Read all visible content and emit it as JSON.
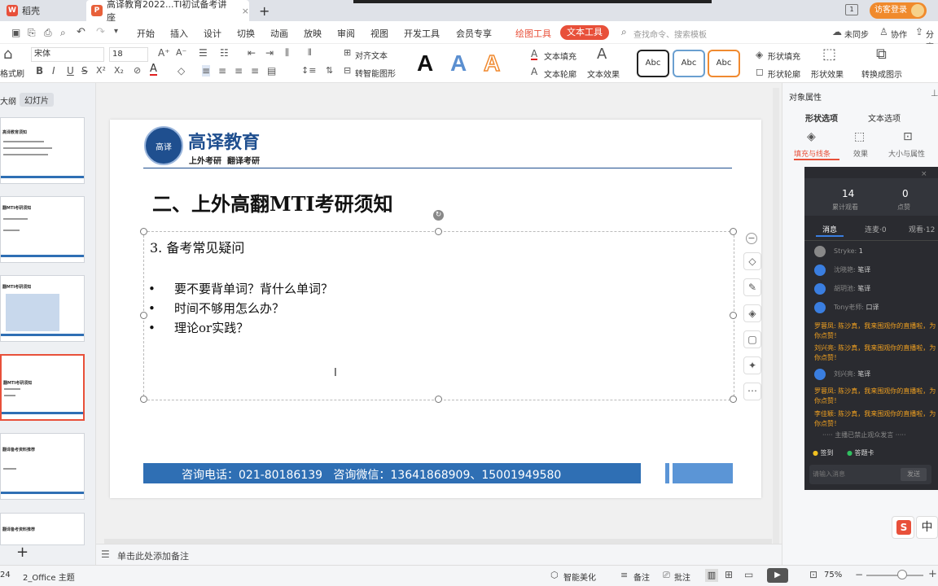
{
  "tabs": {
    "home": "稻壳",
    "doc": "高译教育2022...TI初试备考讲座",
    "add": "+"
  },
  "titlebar": {
    "login_button": "访客登录",
    "mode_icon": "1"
  },
  "menu": {
    "file": "文件",
    "items": [
      "开始",
      "插入",
      "设计",
      "切换",
      "动画",
      "放映",
      "审阅",
      "视图",
      "开发工具",
      "会员专享"
    ],
    "drawing_tool": "绘图工具",
    "text_tool": "文本工具",
    "search": "查找命令、搜索模板",
    "sync": "未同步",
    "collab": "协作",
    "share": "分享"
  },
  "ribbon": {
    "format_brush": "格式刷",
    "font_name": "宋体",
    "font_size": "18",
    "align_text": "对齐文本",
    "smart_art": "转智能图形",
    "text_fill": "文本填充",
    "text_outline": "文本轮廓",
    "text_effects": "文本效果",
    "styles": [
      "Abc",
      "Abc",
      "Abc"
    ],
    "shape_fill": "形状填充",
    "shape_outline": "形状轮廓",
    "shape_effects": "形状效果",
    "convert_to_image": "转换成图示",
    "big_a": "A",
    "bold": "B",
    "italic": "I",
    "underline": "U",
    "strike": "S"
  },
  "leftpanel": {
    "tab_outline": "大纲",
    "tab_slides": "幻灯片",
    "add": "+",
    "thumb_titles": [
      "高译教育须知",
      "翻MTI考研须知",
      "翻MTI考研须知",
      "翻MTI考研须知",
      "翻译备考资料推荐",
      "翻译备考资料推荐"
    ]
  },
  "slide": {
    "logo_name": "高译教育",
    "logo_sub": "上外考研  翻译考研",
    "title": "二、上外高翻MTI考研须知",
    "subtitle": "3. 备考常见疑问",
    "bullets": [
      "要不要背单词？背什么单词？",
      "时间不够用怎么办？",
      "理论or实践？"
    ],
    "footer": "咨询电话：021-80186139   咨询微信：13641868909、15001949580"
  },
  "notes": {
    "placeholder": "单击此处添加备注"
  },
  "rightpanel": {
    "title": "对象属性",
    "tabs": [
      "形状选项",
      "文本选项"
    ],
    "subtabs": [
      "填充与线条",
      "效果",
      "大小与属性"
    ]
  },
  "live": {
    "stats": [
      {
        "value": "14",
        "label": "累计观看"
      },
      {
        "value": "0",
        "label": "点赞"
      }
    ],
    "tabs": [
      "消息",
      "连麦·0",
      "观看·12"
    ],
    "messages": [
      {
        "user": "Stryke",
        "text": "1",
        "color": "#aaaaaa"
      },
      {
        "user": "沈晓艳",
        "text": "笔译",
        "color": "#aaaaaa"
      },
      {
        "user": "胡玥池",
        "text": "笔译",
        "color": "#aaaaaa"
      },
      {
        "user": "Tony老师",
        "text": "口译",
        "color": "#aaaaaa"
      },
      {
        "user": "罗蓉凤",
        "text": "陈沙真，我来围观你的直播啦，为你点赞！",
        "color": "#f0a020"
      },
      {
        "user": "刘兴亮",
        "text": "陈沙真，我来围观你的直播啦，为你点赞！",
        "color": "#f0a020"
      },
      {
        "user": "刘兴亮",
        "text": "笔译",
        "color": "#aaaaaa"
      },
      {
        "user": "罗蓉凤",
        "text": "陈沙真，我来围观你的直播啦，为你点赞！",
        "color": "#f0a020"
      },
      {
        "user": "李佳颖",
        "text": "陈沙真，我来围观你的直播啦，为你点赞！",
        "color": "#f0a020"
      }
    ],
    "end_note": "····· 主播已禁止观众发言 ·····",
    "checkin": "签到",
    "questions": "答题卡",
    "input_placeholder": "请输入消息",
    "send": "发送"
  },
  "status": {
    "page": "24",
    "theme": "2_Office 主题",
    "beautify": "智能美化",
    "notes": "备注",
    "comments": "批注",
    "zoom": "75%"
  },
  "ime": {
    "lang": "中",
    "app": "S"
  }
}
